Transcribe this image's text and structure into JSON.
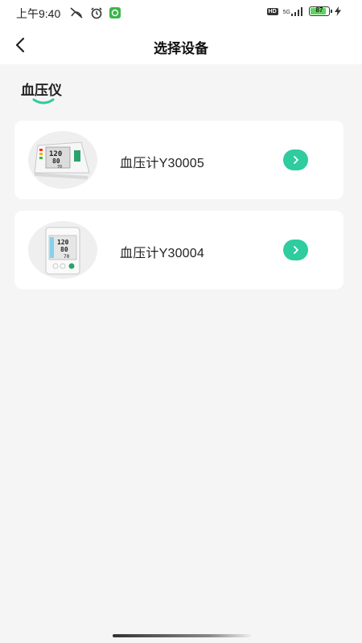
{
  "status_bar": {
    "time": "上午9:40",
    "hd_badge": "HD",
    "network": "5G",
    "battery_level": "87",
    "battery_fraction": 0.87
  },
  "nav": {
    "back_icon": "chevron-left-icon",
    "title": "选择设备"
  },
  "section": {
    "title": "血压仪",
    "accent_color": "#2ecc9e"
  },
  "devices": [
    {
      "name": "血压计Y30005",
      "thumb": "blood-pressure-monitor-arm-icon",
      "action_icon": "chevron-right-icon"
    },
    {
      "name": "血压计Y30004",
      "thumb": "blood-pressure-monitor-wrist-icon",
      "action_icon": "chevron-right-icon"
    }
  ],
  "colors": {
    "background": "#f5f5f5",
    "card": "#ffffff",
    "accent": "#2ecc9e"
  }
}
